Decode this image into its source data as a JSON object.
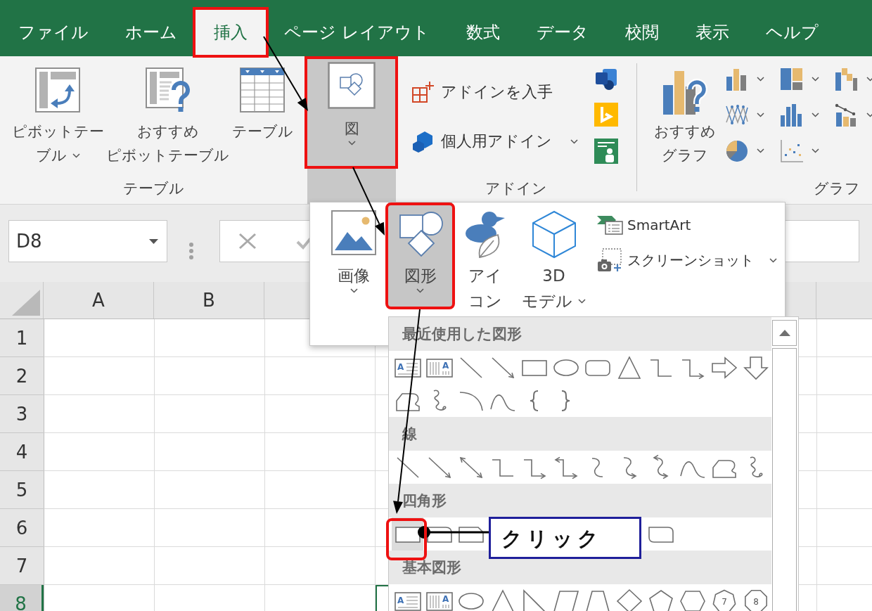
{
  "tabs": [
    {
      "label": "ファイル",
      "selected": false,
      "framed": false
    },
    {
      "label": "ホーム",
      "selected": false,
      "framed": false
    },
    {
      "label": "挿入",
      "selected": true,
      "framed": true
    },
    {
      "label": "ページ レイアウト",
      "selected": false,
      "framed": false
    },
    {
      "label": "数式",
      "selected": false,
      "framed": false
    },
    {
      "label": "データ",
      "selected": false,
      "framed": false
    },
    {
      "label": "校閲",
      "selected": false,
      "framed": false
    },
    {
      "label": "表示",
      "selected": false,
      "framed": false
    },
    {
      "label": "ヘルプ",
      "selected": false,
      "framed": false
    }
  ],
  "ribbon": {
    "table_group": {
      "label": "テーブル",
      "buttons": [
        {
          "kind": "pivot_table",
          "lines": [
            "ピボットテー",
            "ブル"
          ],
          "dropdown": true
        },
        {
          "kind": "recommended_pivot",
          "lines": [
            "おすすめ",
            "ピボットテーブル"
          ],
          "dropdown": false
        },
        {
          "kind": "table",
          "lines": [
            "テーブル"
          ],
          "dropdown": false
        }
      ]
    },
    "illustrations": {
      "lines": [
        "図"
      ],
      "dropdown": true,
      "expanded": true,
      "framed": true
    },
    "addins_group": {
      "label": "アドイン",
      "commands": [
        {
          "kind": "get_addins",
          "label": "アドインを入手",
          "dropdown": false
        },
        {
          "kind": "my_addins",
          "label": "個人用アドイン",
          "dropdown": true
        }
      ],
      "apps": [
        {
          "kind": "visio"
        },
        {
          "kind": "bing"
        },
        {
          "kind": "people_graph"
        }
      ]
    },
    "charts_group": {
      "label": "グラフ",
      "recommended": {
        "lines": [
          "おすすめ",
          "グラフ"
        ]
      },
      "chart_types": [
        {
          "kind": "column",
          "dropdown": true
        },
        {
          "kind": "hierarchy",
          "dropdown": true
        },
        {
          "kind": "waterfall",
          "dropdown": true
        },
        {
          "kind": "line",
          "dropdown": true
        },
        {
          "kind": "statistic",
          "dropdown": true
        },
        {
          "kind": "combo",
          "dropdown": true
        },
        {
          "kind": "pie",
          "dropdown": true
        },
        {
          "kind": "scatter",
          "dropdown": true
        }
      ]
    }
  },
  "formula_bar": {
    "name_box": "D8"
  },
  "sheet": {
    "columns": [
      {
        "label": "A",
        "selected": false
      },
      {
        "label": "B",
        "selected": false
      }
    ],
    "rows": [
      {
        "label": "1",
        "selected": false
      },
      {
        "label": "2",
        "selected": false
      },
      {
        "label": "3",
        "selected": false
      },
      {
        "label": "4",
        "selected": false
      },
      {
        "label": "5",
        "selected": false
      },
      {
        "label": "6",
        "selected": false
      },
      {
        "label": "7",
        "selected": false
      },
      {
        "label": "8",
        "selected": true
      }
    ]
  },
  "illustrations_menu": {
    "items": [
      {
        "kind": "image",
        "lines": [
          "画像"
        ],
        "dropdown": true,
        "selected": false,
        "framed": false
      },
      {
        "kind": "shapes",
        "lines": [
          "図形"
        ],
        "dropdown": true,
        "selected": true,
        "framed": true
      },
      {
        "kind": "icons",
        "lines": [
          "アイ",
          "コン"
        ],
        "dropdown": false,
        "selected": false,
        "framed": false
      },
      {
        "kind": "model_3d",
        "lines": [
          "3D",
          "モデル"
        ],
        "dropdown": true,
        "selected": false,
        "framed": false
      }
    ],
    "side_items": [
      {
        "kind": "smartart",
        "label": "SmartArt",
        "dropdown": false
      },
      {
        "kind": "screenshot",
        "label": "スクリーンショット",
        "dropdown": true
      }
    ]
  },
  "shape_gallery": {
    "sections": [
      {
        "title": "最近使用した図形",
        "shapes": [
          {
            "kind": "textbox",
            "label": "A",
            "selected": false,
            "framed": false
          },
          {
            "kind": "vertical_textbox",
            "label": "A",
            "selected": false,
            "framed": false
          },
          {
            "kind": "line",
            "selected": false,
            "framed": false
          },
          {
            "kind": "arrow",
            "selected": false,
            "framed": false
          },
          {
            "kind": "rect",
            "selected": false,
            "framed": false
          },
          {
            "kind": "oval",
            "selected": false,
            "framed": false
          },
          {
            "kind": "rounded_rect",
            "selected": false,
            "framed": false
          },
          {
            "kind": "triangle",
            "selected": false,
            "framed": false
          },
          {
            "kind": "elbow",
            "selected": false,
            "framed": false
          },
          {
            "kind": "elbow_arrow",
            "selected": false,
            "framed": false
          },
          {
            "kind": "right_arrow",
            "selected": false,
            "framed": false
          },
          {
            "kind": "down_arrow",
            "selected": false,
            "framed": false
          },
          {
            "kind": "freeform",
            "selected": false,
            "framed": false
          },
          {
            "kind": "scribble",
            "selected": false,
            "framed": false
          },
          {
            "kind": "arc",
            "selected": false,
            "framed": false
          },
          {
            "kind": "curve",
            "selected": false,
            "framed": false
          },
          {
            "kind": "left_brace",
            "selected": false,
            "framed": false
          },
          {
            "kind": "right_brace",
            "selected": false,
            "framed": false
          }
        ]
      },
      {
        "title": "線",
        "shapes": [
          {
            "kind": "line",
            "selected": false,
            "framed": false
          },
          {
            "kind": "arrow",
            "selected": false,
            "framed": false
          },
          {
            "kind": "double_arrow",
            "selected": false,
            "framed": false
          },
          {
            "kind": "elbow",
            "selected": false,
            "framed": false
          },
          {
            "kind": "elbow_arrow",
            "selected": false,
            "framed": false
          },
          {
            "kind": "elbow_double_arrow",
            "selected": false,
            "framed": false
          },
          {
            "kind": "curved_connector",
            "selected": false,
            "framed": false
          },
          {
            "kind": "curved_arrow",
            "selected": false,
            "framed": false
          },
          {
            "kind": "curved_double_arrow",
            "selected": false,
            "framed": false
          },
          {
            "kind": "curve",
            "selected": false,
            "framed": false
          },
          {
            "kind": "freeform",
            "selected": false,
            "framed": false
          },
          {
            "kind": "scribble",
            "selected": false,
            "framed": false
          }
        ]
      },
      {
        "title": "四角形",
        "shapes": [
          {
            "kind": "rect",
            "selected": true,
            "framed": true
          },
          {
            "kind": "round_corner_rect",
            "selected": false,
            "framed": false
          },
          {
            "kind": "snip_corner_rect",
            "selected": false,
            "framed": false
          }
        ],
        "callout": {
          "text": "クリック"
        },
        "shapes_after_callout": [
          {
            "kind": "round_diagonal_rect",
            "selected": false,
            "framed": false
          }
        ]
      },
      {
        "title": "基本図形",
        "shapes": [
          {
            "kind": "textbox",
            "label": "A",
            "selected": false,
            "framed": false
          },
          {
            "kind": "vertical_textbox",
            "label": "A",
            "selected": false,
            "framed": false
          },
          {
            "kind": "oval",
            "selected": false,
            "framed": false
          },
          {
            "kind": "triangle",
            "selected": false,
            "framed": false
          },
          {
            "kind": "right_triangle",
            "selected": false,
            "framed": false
          },
          {
            "kind": "parallelogram",
            "selected": false,
            "framed": false
          },
          {
            "kind": "trapezoid",
            "selected": false,
            "framed": false
          },
          {
            "kind": "diamond",
            "selected": false,
            "framed": false
          },
          {
            "kind": "pentagon",
            "selected": false,
            "framed": false
          },
          {
            "kind": "hexagon",
            "selected": false,
            "framed": false
          },
          {
            "kind": "heptagon",
            "label": "7",
            "selected": false,
            "framed": false
          },
          {
            "kind": "octagon",
            "label": "8",
            "selected": false,
            "framed": false
          }
        ]
      }
    ]
  }
}
